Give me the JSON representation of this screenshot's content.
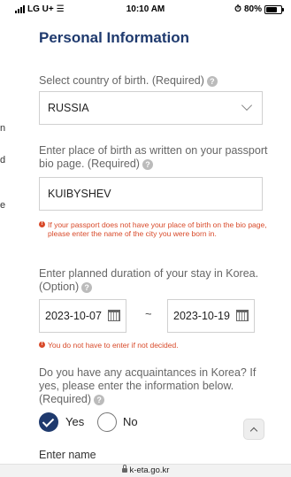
{
  "status_bar": {
    "carrier": "LG U+",
    "time": "10:10 AM",
    "battery": "80%"
  },
  "page_title": "Personal Information",
  "country": {
    "label": "Select country of birth. (Required)",
    "value": "RUSSIA"
  },
  "birthplace": {
    "label": "Enter place of birth as written on your passport bio page. (Required)",
    "value": "KUIBYSHEV",
    "note": "If your passport does not have your place of birth on the bio page, please enter the name of the city you were born in."
  },
  "stay": {
    "label": "Enter planned duration of your stay in Korea.(Option)",
    "start": "2023-10-07",
    "separator": "~",
    "end": "2023-10-19",
    "note": "You do not have to enter if not decided."
  },
  "acquaintances": {
    "label": "Do you have any acquaintances in Korea? If yes, please enter the information below. (Required)",
    "yes": "Yes",
    "no": "No",
    "selected": "Yes"
  },
  "name_label": "Enter name",
  "url_bar": "k-eta.go.kr",
  "left_edge_fragments": [
    "n",
    "d",
    "e"
  ]
}
